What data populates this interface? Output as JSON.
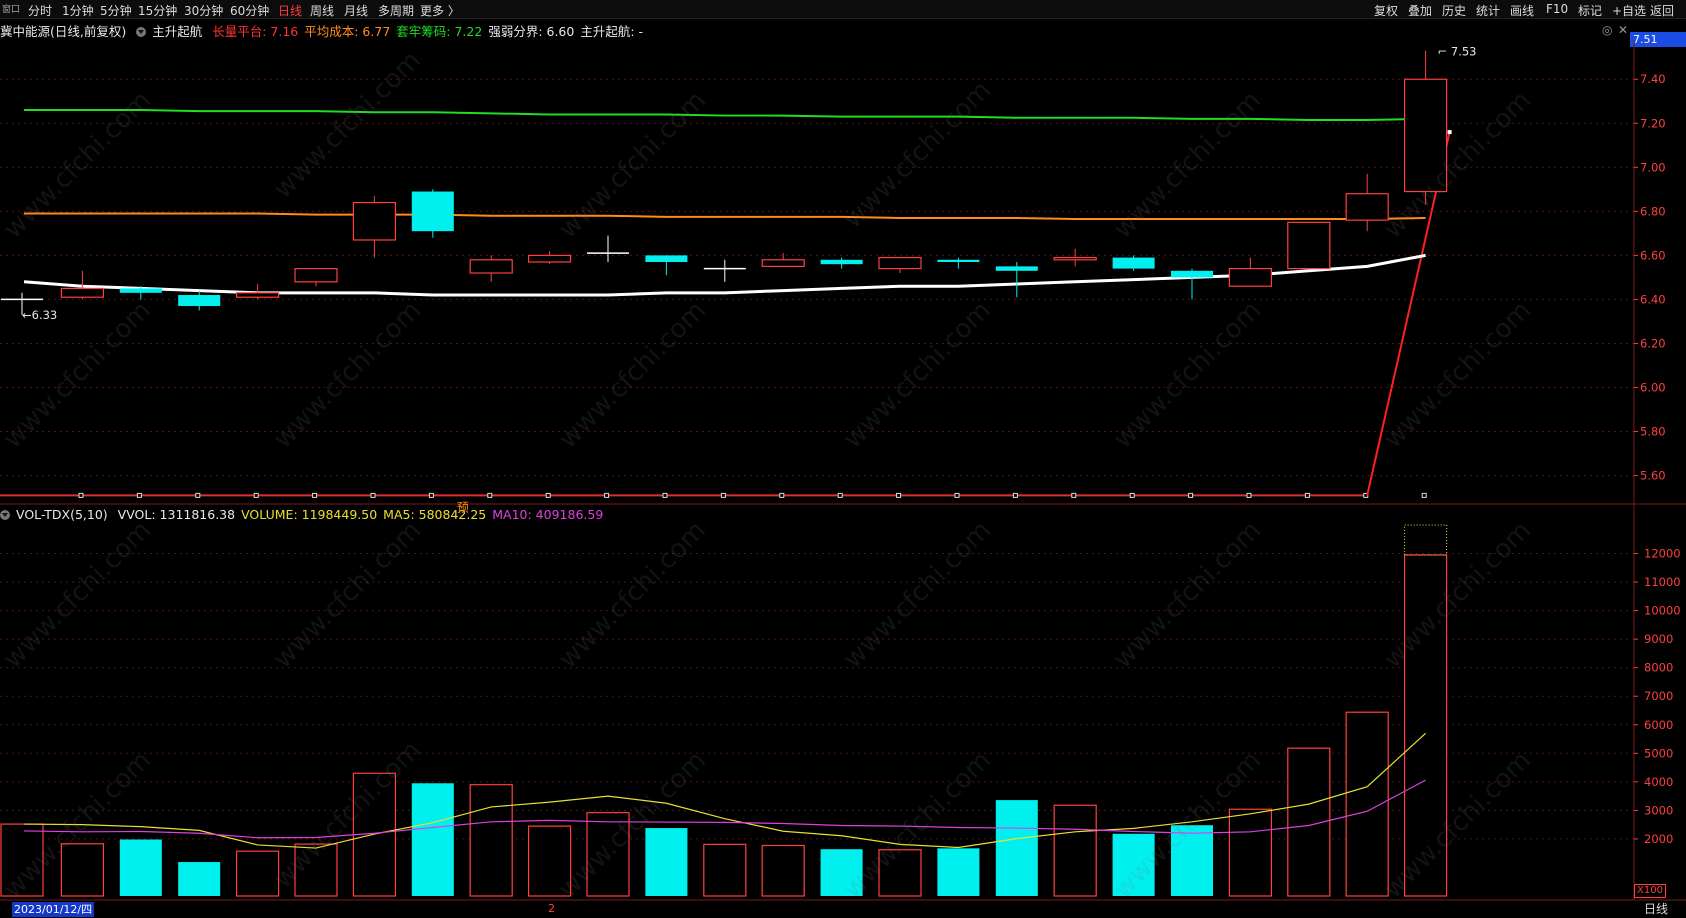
{
  "toolbar": {
    "left_icon": "窗口",
    "periods": [
      {
        "label": "分时"
      },
      {
        "label": "1分钟"
      },
      {
        "label": "5分钟"
      },
      {
        "label": "15分钟"
      },
      {
        "label": "30分钟"
      },
      {
        "label": "60分钟"
      },
      {
        "label": "日线",
        "active": true
      },
      {
        "label": "周线"
      },
      {
        "label": "月线"
      },
      {
        "label": "多周期"
      },
      {
        "label": "更多 〉"
      }
    ],
    "right_items": [
      {
        "label": "复权"
      },
      {
        "label": "叠加"
      },
      {
        "label": "历史"
      },
      {
        "label": "统计"
      },
      {
        "label": "画线"
      },
      {
        "label": "F10"
      },
      {
        "label": "标记"
      },
      {
        "label": "+自选"
      },
      {
        "label": "返回"
      }
    ]
  },
  "infobar": {
    "stock": "冀中能源(日线,前复权)",
    "indicator": "主升起航",
    "pairs": [
      {
        "label": "长量平台:",
        "value": "7.16",
        "color": "#ff3333"
      },
      {
        "label": "平均成本:",
        "value": "6.77",
        "color": "#ff8c1a"
      },
      {
        "label": "套牢筹码:",
        "value": "7.22",
        "color": "#22dd22"
      },
      {
        "label": "强弱分界:",
        "value": "6.60",
        "color": "#e8e8e8"
      },
      {
        "label": "主升起航:",
        "value": "-",
        "color": "#e8e8e8"
      }
    ]
  },
  "volinfo": {
    "name": "VOL-TDX(5,10)",
    "pairs": [
      {
        "label": "VVOL:",
        "value": "1311816.38",
        "color": "#e8e8e8"
      },
      {
        "label": "VOLUME:",
        "value": "1198449.50",
        "color": "#e8e030"
      },
      {
        "label": "MA5:",
        "value": "580842.25",
        "color": "#e8e030"
      },
      {
        "label": "MA10:",
        "value": "409186.59",
        "color": "#e040e0"
      }
    ]
  },
  "price_axis_ticks": [
    "7.40",
    "7.20",
    "7.00",
    "6.80",
    "6.60",
    "6.40",
    "6.20",
    "6.00",
    "5.80",
    "5.60"
  ],
  "volume_axis_ticks": [
    "12000",
    "11000",
    "10000",
    "9000",
    "8000",
    "7000",
    "6000",
    "5000",
    "4000",
    "3000",
    "2000"
  ],
  "current_price": "7.51",
  "high_label": "7.53",
  "low_label": "6.33",
  "marker_label": "预",
  "bottom_date": "2023/01/12/四",
  "bottom_marker": "2",
  "bottom_period": "日线",
  "volume_unit": "X100",
  "watermark": "www.cfchi.com",
  "colors": {
    "up": "#ff4040",
    "down": "#00f0f0",
    "ma_green": "#22dd22",
    "ma_orange": "#ff8c1a",
    "ma_white": "#ffffff",
    "vol_ma5": "#e8e030",
    "vol_ma10": "#e040e0"
  },
  "chart_data": {
    "type": "candlestick",
    "series_candles": [
      {
        "o": 6.4,
        "c": 6.4,
        "h": 6.43,
        "l": 6.33
      },
      {
        "o": 6.41,
        "c": 6.45,
        "h": 6.53,
        "l": 6.4
      },
      {
        "o": 6.45,
        "c": 6.43,
        "h": 6.46,
        "l": 6.4
      },
      {
        "o": 6.42,
        "c": 6.37,
        "h": 6.44,
        "l": 6.35
      },
      {
        "o": 6.41,
        "c": 6.43,
        "h": 6.47,
        "l": 6.4
      },
      {
        "o": 6.48,
        "c": 6.54,
        "h": 6.54,
        "l": 6.46
      },
      {
        "o": 6.67,
        "c": 6.84,
        "h": 6.87,
        "l": 6.59
      },
      {
        "o": 6.89,
        "c": 6.71,
        "h": 6.9,
        "l": 6.68
      },
      {
        "o": 6.52,
        "c": 6.58,
        "h": 6.6,
        "l": 6.48
      },
      {
        "o": 6.57,
        "c": 6.6,
        "h": 6.62,
        "l": 6.56
      },
      {
        "o": 6.61,
        "c": 6.61,
        "h": 6.69,
        "l": 6.57
      },
      {
        "o": 6.6,
        "c": 6.57,
        "h": 6.6,
        "l": 6.51
      },
      {
        "o": 6.54,
        "c": 6.54,
        "h": 6.58,
        "l": 6.48
      },
      {
        "o": 6.55,
        "c": 6.58,
        "h": 6.61,
        "l": 6.55
      },
      {
        "o": 6.58,
        "c": 6.56,
        "h": 6.59,
        "l": 6.54
      },
      {
        "o": 6.54,
        "c": 6.59,
        "h": 6.59,
        "l": 6.52
      },
      {
        "o": 6.58,
        "c": 6.57,
        "h": 6.59,
        "l": 6.54
      },
      {
        "o": 6.55,
        "c": 6.53,
        "h": 6.57,
        "l": 6.41
      },
      {
        "o": 6.58,
        "c": 6.59,
        "h": 6.63,
        "l": 6.55
      },
      {
        "o": 6.59,
        "c": 6.54,
        "h": 6.6,
        "l": 6.53
      },
      {
        "o": 6.53,
        "c": 6.5,
        "h": 6.54,
        "l": 6.4
      },
      {
        "o": 6.46,
        "c": 6.54,
        "h": 6.59,
        "l": 6.46
      },
      {
        "o": 6.54,
        "c": 6.75,
        "h": 6.75,
        "l": 6.54
      },
      {
        "o": 6.76,
        "c": 6.88,
        "h": 6.97,
        "l": 6.71
      },
      {
        "o": 6.89,
        "c": 7.4,
        "h": 7.53,
        "l": 6.83
      }
    ],
    "lines": {
      "green": [
        7.26,
        7.26,
        7.26,
        7.255,
        7.255,
        7.255,
        7.25,
        7.25,
        7.245,
        7.24,
        7.24,
        7.24,
        7.235,
        7.235,
        7.23,
        7.23,
        7.23,
        7.225,
        7.225,
        7.225,
        7.22,
        7.22,
        7.215,
        7.215,
        7.22
      ],
      "orange": [
        6.79,
        6.79,
        6.79,
        6.79,
        6.79,
        6.785,
        6.785,
        6.785,
        6.78,
        6.78,
        6.78,
        6.775,
        6.775,
        6.775,
        6.775,
        6.77,
        6.77,
        6.77,
        6.765,
        6.765,
        6.765,
        6.765,
        6.765,
        6.765,
        6.77
      ],
      "white": [
        6.48,
        6.46,
        6.45,
        6.44,
        6.43,
        6.43,
        6.43,
        6.42,
        6.42,
        6.42,
        6.42,
        6.43,
        6.43,
        6.44,
        6.45,
        6.46,
        6.46,
        6.47,
        6.48,
        6.49,
        6.5,
        6.51,
        6.53,
        6.55,
        6.6
      ],
      "red_start": 5.51,
      "red_end": 7.16
    },
    "volume": [
      2520,
      1830,
      1980,
      1190,
      1570,
      1820,
      4300,
      3950,
      3900,
      2450,
      2920,
      2380,
      1810,
      1770,
      1640,
      1620,
      1670,
      3360,
      3180,
      2180,
      2480,
      3040,
      5180,
      6440,
      11950
    ],
    "vol_ma5": [
      2520,
      2500,
      2430,
      2300,
      1790,
      1680,
      2170,
      2570,
      3120,
      3290,
      3500,
      3250,
      2710,
      2270,
      2110,
      1810,
      1700,
      2010,
      2250,
      2370,
      2600,
      2880,
      3220,
      3830,
      5700
    ],
    "vol_ma10": [
      2280,
      2250,
      2260,
      2200,
      2040,
      2050,
      2200,
      2400,
      2600,
      2650,
      2600,
      2590,
      2580,
      2540,
      2470,
      2450,
      2400,
      2380,
      2340,
      2260,
      2200,
      2250,
      2470,
      2970,
      4060
    ],
    "price_ylim": [
      5.48,
      7.56
    ],
    "volume_ylim": [
      0,
      13000
    ]
  }
}
